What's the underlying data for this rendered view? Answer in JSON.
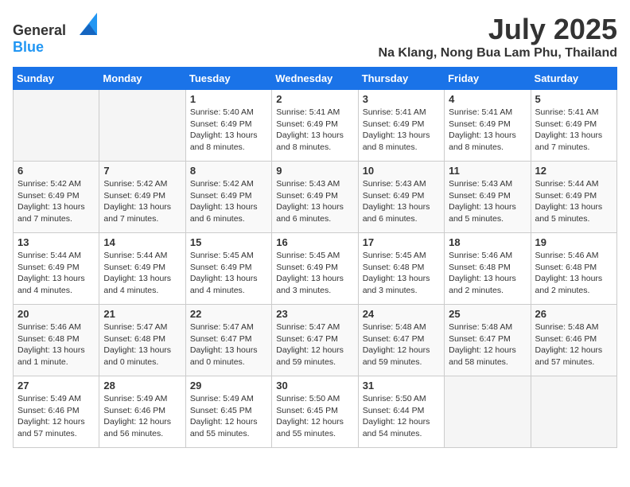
{
  "header": {
    "logo_general": "General",
    "logo_blue": "Blue",
    "title": "July 2025",
    "subtitle": "Na Klang, Nong Bua Lam Phu, Thailand"
  },
  "calendar": {
    "days_of_week": [
      "Sunday",
      "Monday",
      "Tuesday",
      "Wednesday",
      "Thursday",
      "Friday",
      "Saturday"
    ],
    "weeks": [
      [
        {
          "day": "",
          "info": ""
        },
        {
          "day": "",
          "info": ""
        },
        {
          "day": "1",
          "info": "Sunrise: 5:40 AM\nSunset: 6:49 PM\nDaylight: 13 hours and 8 minutes."
        },
        {
          "day": "2",
          "info": "Sunrise: 5:41 AM\nSunset: 6:49 PM\nDaylight: 13 hours and 8 minutes."
        },
        {
          "day": "3",
          "info": "Sunrise: 5:41 AM\nSunset: 6:49 PM\nDaylight: 13 hours and 8 minutes."
        },
        {
          "day": "4",
          "info": "Sunrise: 5:41 AM\nSunset: 6:49 PM\nDaylight: 13 hours and 8 minutes."
        },
        {
          "day": "5",
          "info": "Sunrise: 5:41 AM\nSunset: 6:49 PM\nDaylight: 13 hours and 7 minutes."
        }
      ],
      [
        {
          "day": "6",
          "info": "Sunrise: 5:42 AM\nSunset: 6:49 PM\nDaylight: 13 hours and 7 minutes."
        },
        {
          "day": "7",
          "info": "Sunrise: 5:42 AM\nSunset: 6:49 PM\nDaylight: 13 hours and 7 minutes."
        },
        {
          "day": "8",
          "info": "Sunrise: 5:42 AM\nSunset: 6:49 PM\nDaylight: 13 hours and 6 minutes."
        },
        {
          "day": "9",
          "info": "Sunrise: 5:43 AM\nSunset: 6:49 PM\nDaylight: 13 hours and 6 minutes."
        },
        {
          "day": "10",
          "info": "Sunrise: 5:43 AM\nSunset: 6:49 PM\nDaylight: 13 hours and 6 minutes."
        },
        {
          "day": "11",
          "info": "Sunrise: 5:43 AM\nSunset: 6:49 PM\nDaylight: 13 hours and 5 minutes."
        },
        {
          "day": "12",
          "info": "Sunrise: 5:44 AM\nSunset: 6:49 PM\nDaylight: 13 hours and 5 minutes."
        }
      ],
      [
        {
          "day": "13",
          "info": "Sunrise: 5:44 AM\nSunset: 6:49 PM\nDaylight: 13 hours and 4 minutes."
        },
        {
          "day": "14",
          "info": "Sunrise: 5:44 AM\nSunset: 6:49 PM\nDaylight: 13 hours and 4 minutes."
        },
        {
          "day": "15",
          "info": "Sunrise: 5:45 AM\nSunset: 6:49 PM\nDaylight: 13 hours and 4 minutes."
        },
        {
          "day": "16",
          "info": "Sunrise: 5:45 AM\nSunset: 6:49 PM\nDaylight: 13 hours and 3 minutes."
        },
        {
          "day": "17",
          "info": "Sunrise: 5:45 AM\nSunset: 6:48 PM\nDaylight: 13 hours and 3 minutes."
        },
        {
          "day": "18",
          "info": "Sunrise: 5:46 AM\nSunset: 6:48 PM\nDaylight: 13 hours and 2 minutes."
        },
        {
          "day": "19",
          "info": "Sunrise: 5:46 AM\nSunset: 6:48 PM\nDaylight: 13 hours and 2 minutes."
        }
      ],
      [
        {
          "day": "20",
          "info": "Sunrise: 5:46 AM\nSunset: 6:48 PM\nDaylight: 13 hours and 1 minute."
        },
        {
          "day": "21",
          "info": "Sunrise: 5:47 AM\nSunset: 6:48 PM\nDaylight: 13 hours and 0 minutes."
        },
        {
          "day": "22",
          "info": "Sunrise: 5:47 AM\nSunset: 6:47 PM\nDaylight: 13 hours and 0 minutes."
        },
        {
          "day": "23",
          "info": "Sunrise: 5:47 AM\nSunset: 6:47 PM\nDaylight: 12 hours and 59 minutes."
        },
        {
          "day": "24",
          "info": "Sunrise: 5:48 AM\nSunset: 6:47 PM\nDaylight: 12 hours and 59 minutes."
        },
        {
          "day": "25",
          "info": "Sunrise: 5:48 AM\nSunset: 6:47 PM\nDaylight: 12 hours and 58 minutes."
        },
        {
          "day": "26",
          "info": "Sunrise: 5:48 AM\nSunset: 6:46 PM\nDaylight: 12 hours and 57 minutes."
        }
      ],
      [
        {
          "day": "27",
          "info": "Sunrise: 5:49 AM\nSunset: 6:46 PM\nDaylight: 12 hours and 57 minutes."
        },
        {
          "day": "28",
          "info": "Sunrise: 5:49 AM\nSunset: 6:46 PM\nDaylight: 12 hours and 56 minutes."
        },
        {
          "day": "29",
          "info": "Sunrise: 5:49 AM\nSunset: 6:45 PM\nDaylight: 12 hours and 55 minutes."
        },
        {
          "day": "30",
          "info": "Sunrise: 5:50 AM\nSunset: 6:45 PM\nDaylight: 12 hours and 55 minutes."
        },
        {
          "day": "31",
          "info": "Sunrise: 5:50 AM\nSunset: 6:44 PM\nDaylight: 12 hours and 54 minutes."
        },
        {
          "day": "",
          "info": ""
        },
        {
          "day": "",
          "info": ""
        }
      ]
    ]
  }
}
